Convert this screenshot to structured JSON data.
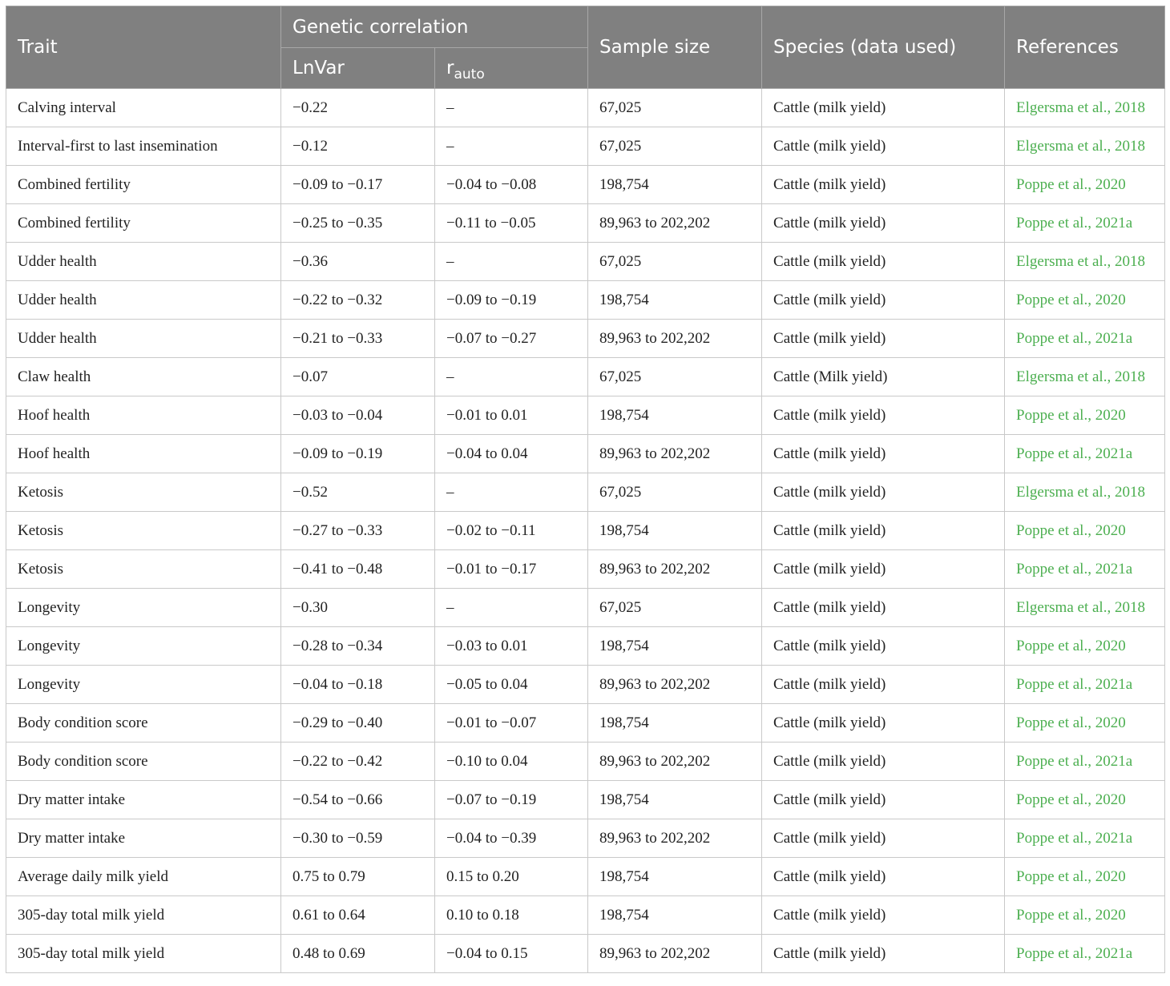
{
  "headers": {
    "trait": "Trait",
    "genetic_correlation": "Genetic correlation",
    "lnvar": "LnVar",
    "rauto_base": "r",
    "rauto_sub": "auto",
    "sample_size": "Sample size",
    "species": "Species (data used)",
    "references": "References"
  },
  "rows": [
    {
      "trait": "Calving interval",
      "lnvar": "−0.22",
      "rauto": "–",
      "sample": "67,025",
      "species": "Cattle (milk yield)",
      "ref": "Elgersma et al., 2018"
    },
    {
      "trait": "Interval-first to last insemination",
      "lnvar": "−0.12",
      "rauto": "–",
      "sample": "67,025",
      "species": "Cattle (milk yield)",
      "ref": "Elgersma et al., 2018"
    },
    {
      "trait": "Combined fertility",
      "lnvar": "−0.09 to −0.17",
      "rauto": "−0.04 to −0.08",
      "sample": "198,754",
      "species": "Cattle (milk yield)",
      "ref": "Poppe et al., 2020"
    },
    {
      "trait": "Combined fertility",
      "lnvar": "−0.25 to −0.35",
      "rauto": "−0.11 to −0.05",
      "sample": "89,963 to 202,202",
      "species": "Cattle (milk yield)",
      "ref": "Poppe et al., 2021a"
    },
    {
      "trait": "Udder health",
      "lnvar": "−0.36",
      "rauto": "–",
      "sample": "67,025",
      "species": "Cattle (milk yield)",
      "ref": "Elgersma et al., 2018"
    },
    {
      "trait": "Udder health",
      "lnvar": "−0.22 to −0.32",
      "rauto": "−0.09 to −0.19",
      "sample": "198,754",
      "species": "Cattle (milk yield)",
      "ref": "Poppe et al., 2020"
    },
    {
      "trait": "Udder health",
      "lnvar": "−0.21 to −0.33",
      "rauto": "−0.07 to −0.27",
      "sample": "89,963 to 202,202",
      "species": "Cattle (milk yield)",
      "ref": "Poppe et al., 2021a"
    },
    {
      "trait": "Claw health",
      "lnvar": "−0.07",
      "rauto": "–",
      "sample": "67,025",
      "species": "Cattle (Milk yield)",
      "ref": "Elgersma et al., 2018"
    },
    {
      "trait": "Hoof health",
      "lnvar": "−0.03 to −0.04",
      "rauto": "−0.01 to 0.01",
      "sample": "198,754",
      "species": "Cattle (milk yield)",
      "ref": "Poppe et al., 2020"
    },
    {
      "trait": "Hoof health",
      "lnvar": "−0.09 to −0.19",
      "rauto": "−0.04 to 0.04",
      "sample": "89,963 to 202,202",
      "species": "Cattle (milk yield)",
      "ref": "Poppe et al., 2021a"
    },
    {
      "trait": "Ketosis",
      "lnvar": "−0.52",
      "rauto": "–",
      "sample": "67,025",
      "species": "Cattle (milk yield)",
      "ref": "Elgersma et al., 2018"
    },
    {
      "trait": "Ketosis",
      "lnvar": "−0.27 to −0.33",
      "rauto": "−0.02 to −0.11",
      "sample": "198,754",
      "species": "Cattle (milk yield)",
      "ref": "Poppe et al., 2020"
    },
    {
      "trait": "Ketosis",
      "lnvar": "−0.41 to −0.48",
      "rauto": "−0.01 to −0.17",
      "sample": "89,963 to 202,202",
      "species": "Cattle (milk yield)",
      "ref": "Poppe et al., 2021a"
    },
    {
      "trait": "Longevity",
      "lnvar": "−0.30",
      "rauto": "–",
      "sample": "67,025",
      "species": "Cattle (milk yield)",
      "ref": "Elgersma et al., 2018"
    },
    {
      "trait": "Longevity",
      "lnvar": "−0.28 to −0.34",
      "rauto": "−0.03 to 0.01",
      "sample": "198,754",
      "species": "Cattle (milk yield)",
      "ref": "Poppe et al., 2020"
    },
    {
      "trait": "Longevity",
      "lnvar": "−0.04 to −0.18",
      "rauto": "−0.05 to 0.04",
      "sample": "89,963 to 202,202",
      "species": "Cattle (milk yield)",
      "ref": "Poppe et al., 2021a"
    },
    {
      "trait": "Body condition score",
      "lnvar": "−0.29 to −0.40",
      "rauto": "−0.01 to −0.07",
      "sample": "198,754",
      "species": "Cattle (milk yield)",
      "ref": "Poppe et al., 2020"
    },
    {
      "trait": "Body condition score",
      "lnvar": "−0.22 to −0.42",
      "rauto": "−0.10 to 0.04",
      "sample": "89,963 to 202,202",
      "species": "Cattle (milk yield)",
      "ref": "Poppe et al., 2021a"
    },
    {
      "trait": "Dry matter intake",
      "lnvar": "−0.54 to −0.66",
      "rauto": "−0.07 to −0.19",
      "sample": "198,754",
      "species": "Cattle (milk yield)",
      "ref": "Poppe et al., 2020"
    },
    {
      "trait": "Dry matter intake",
      "lnvar": "−0.30 to −0.59",
      "rauto": "−0.04 to −0.39",
      "sample": "89,963 to 202,202",
      "species": "Cattle (milk yield)",
      "ref": "Poppe et al., 2021a"
    },
    {
      "trait": "Average daily milk yield",
      "lnvar": "0.75 to 0.79",
      "rauto": "0.15 to 0.20",
      "sample": "198,754",
      "species": "Cattle (milk yield)",
      "ref": "Poppe et al., 2020"
    },
    {
      "trait": "305-day total milk yield",
      "lnvar": "0.61 to 0.64",
      "rauto": "0.10 to 0.18",
      "sample": "198,754",
      "species": "Cattle (milk yield)",
      "ref": "Poppe et al., 2020"
    },
    {
      "trait": "305-day total milk yield",
      "lnvar": "0.48 to 0.69",
      "rauto": "−0.04 to 0.15",
      "sample": "89,963 to 202,202",
      "species": "Cattle (milk yield)",
      "ref": "Poppe et al., 2021a"
    }
  ]
}
